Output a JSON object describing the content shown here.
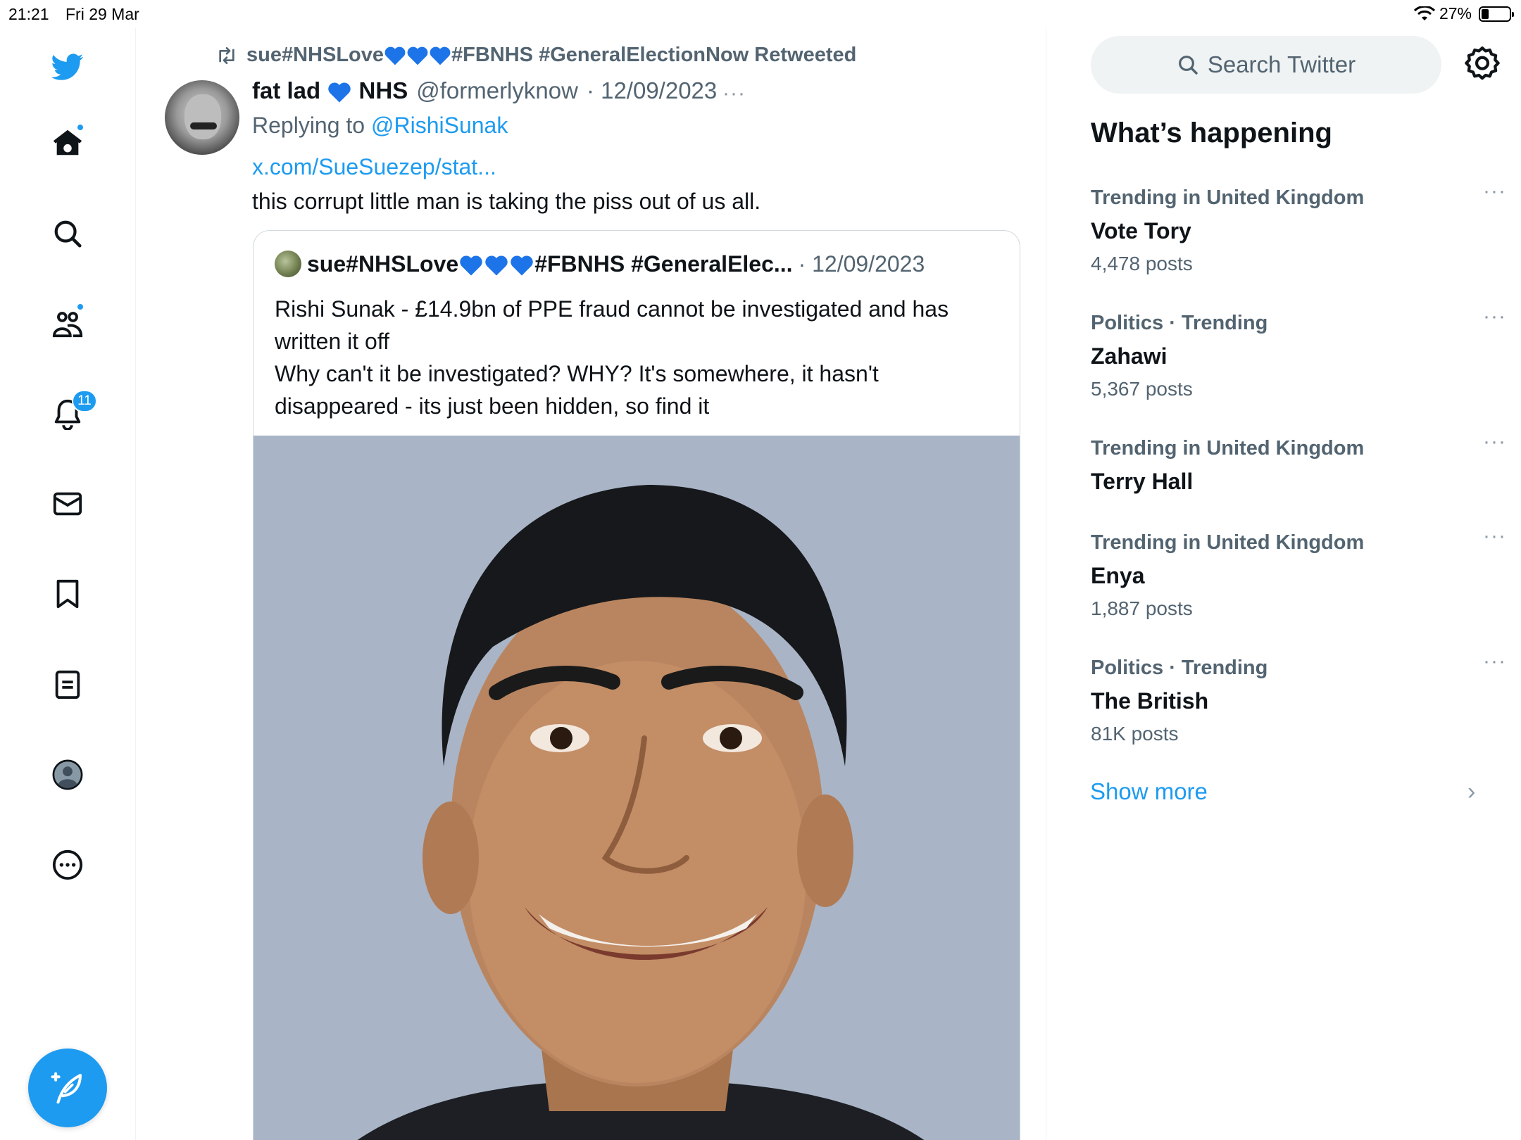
{
  "status_bar": {
    "time": "21:21",
    "date": "Fri 29 Mar",
    "battery_text": "27%",
    "battery_level": 0.27
  },
  "nav": {
    "items": [
      {
        "name": "twitter-logo-icon"
      },
      {
        "name": "home-icon",
        "dot": true
      },
      {
        "name": "explore-icon"
      },
      {
        "name": "communities-icon",
        "dot": true
      },
      {
        "name": "notifications-icon",
        "badge": "11"
      },
      {
        "name": "messages-icon"
      },
      {
        "name": "bookmarks-icon"
      },
      {
        "name": "lists-icon"
      },
      {
        "name": "profile-icon"
      },
      {
        "name": "more-icon"
      }
    ],
    "compose_icon": "compose-feather-icon"
  },
  "tweet": {
    "retweet_user": "sue#NHSLove",
    "retweet_tags": "#FBNHS #GeneralElectionNow Retweeted",
    "author_name_1": "fat lad",
    "author_name_2": "NHS",
    "author_handle": "@formerlyknow",
    "date": "· 12/09/2023",
    "replying_prefix": "Replying to",
    "replying_to": "@RishiSunak",
    "link": "x.com/SueSuezep/stat...",
    "text": "this corrupt little man is taking the piss out of us all.",
    "more": "···"
  },
  "quote": {
    "author": "sue#NHSLove",
    "author_tags": "#FBNHS #GeneralElec...",
    "date": "· 12/09/2023",
    "lines": [
      "Rishi Sunak - £14.9bn of PPE fraud cannot be investigated and has",
      "written it off",
      "Why can't it be investigated? WHY? It's somewhere, it hasn't",
      "disappeared - its just been hidden, so find it"
    ]
  },
  "sidebar": {
    "search_placeholder": "Search Twitter",
    "heading": "What’s happening",
    "trends": [
      {
        "context": "Trending in United Kingdom",
        "name": "Vote Tory",
        "count": "4,478 posts"
      },
      {
        "context": "Politics · Trending",
        "name": "Zahawi",
        "count": "5,367 posts"
      },
      {
        "context": "Trending in United Kingdom",
        "name": "Terry Hall",
        "count": ""
      },
      {
        "context": "Trending in United Kingdom",
        "name": "Enya",
        "count": "1,887 posts"
      },
      {
        "context": "Politics · Trending",
        "name": "The British",
        "count": "81K posts"
      }
    ],
    "show_more": "Show more",
    "show_more_chevron": "›"
  },
  "colors": {
    "accent": "#1d9bf0",
    "text_primary": "#0f1419",
    "text_secondary": "#536471",
    "heart": "#1d74e8"
  }
}
